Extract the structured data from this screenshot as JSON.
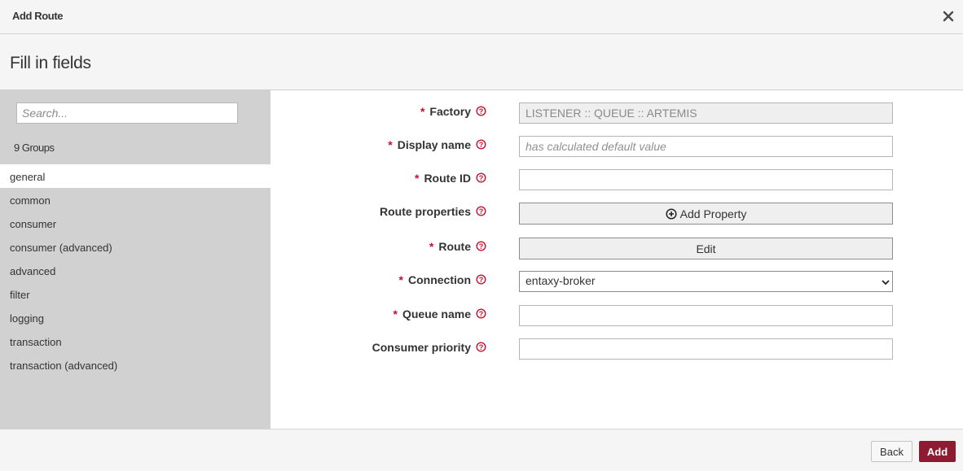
{
  "header": {
    "title": "Add Route",
    "close_icon": "close-icon"
  },
  "page": {
    "title": "Fill in fields"
  },
  "sidebar": {
    "search_placeholder": "Search...",
    "groups_count": "9 Groups",
    "groups": [
      {
        "label": "general",
        "active": true
      },
      {
        "label": "common",
        "active": false
      },
      {
        "label": "consumer",
        "active": false
      },
      {
        "label": "consumer (advanced)",
        "active": false
      },
      {
        "label": "advanced",
        "active": false
      },
      {
        "label": "filter",
        "active": false
      },
      {
        "label": "logging",
        "active": false
      },
      {
        "label": "transaction",
        "active": false
      },
      {
        "label": "transaction (advanced)",
        "active": false
      }
    ]
  },
  "form": {
    "required_marker": "*",
    "factory": {
      "label": "Factory",
      "value": "LISTENER :: QUEUE :: ARTEMIS",
      "required": true
    },
    "display_name": {
      "label": "Display name",
      "placeholder": "has calculated default value",
      "value": "",
      "required": true
    },
    "route_id": {
      "label": "Route ID",
      "value": "",
      "required": true
    },
    "route_properties": {
      "label": "Route properties",
      "button_label": "Add Property",
      "required": false
    },
    "route": {
      "label": "Route",
      "button_label": "Edit",
      "required": true
    },
    "connection": {
      "label": "Connection",
      "value": "entaxy-broker",
      "required": true
    },
    "queue_name": {
      "label": "Queue name",
      "value": "",
      "required": true
    },
    "consumer_priority": {
      "label": "Consumer priority",
      "value": "",
      "required": false
    }
  },
  "footer": {
    "back_label": "Back",
    "add_label": "Add"
  },
  "colors": {
    "accent": "#8e1b32",
    "required": "#c41230",
    "sidebar_bg": "#d1d1d1",
    "header_bg": "#f5f5f5"
  }
}
